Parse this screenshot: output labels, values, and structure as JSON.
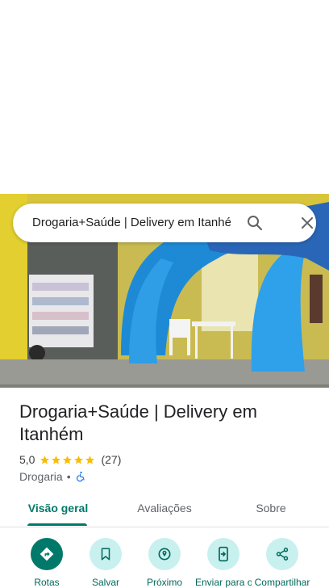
{
  "search": {
    "query": "Drogaria+Saúde | Delivery em Itanhém"
  },
  "place": {
    "title": "Drogaria+Saúde | Delivery em Itanhém",
    "rating": "5,0",
    "stars": 5,
    "review_count": "(27)",
    "category": "Drogaria",
    "separator": "•"
  },
  "tabs": [
    {
      "label": "Visão geral"
    },
    {
      "label": "Avaliações"
    },
    {
      "label": "Sobre"
    }
  ],
  "actions": [
    {
      "label": "Rotas",
      "icon": "directions-icon"
    },
    {
      "label": "Salvar",
      "icon": "bookmark-icon"
    },
    {
      "label": "Próximo",
      "icon": "nearby-icon"
    },
    {
      "label": "Enviar para o smartphone",
      "icon": "send-to-phone-icon"
    },
    {
      "label": "Compartilhar",
      "icon": "share-icon"
    }
  ],
  "colors": {
    "accent": "#00796b",
    "accent_light": "#c8f0ee",
    "star": "#fbbc04",
    "accessible": "#1a73e8"
  }
}
